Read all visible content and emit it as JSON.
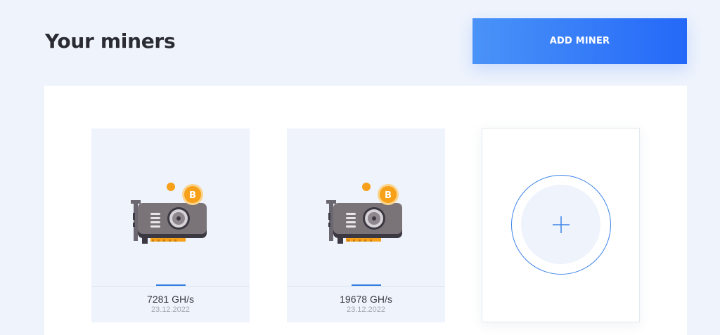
{
  "header": {
    "title": "Your miners",
    "add_button_label": "ADD MINER"
  },
  "colors": {
    "accent": "#2468f8",
    "background": "#eef3fc",
    "bitcoin": "#f7a11a"
  },
  "miners": [
    {
      "icon": "gpu-miner-icon",
      "hashrate": "7281 GH/s",
      "date": "23.12.2022"
    },
    {
      "icon": "gpu-miner-icon",
      "hashrate": "19678 GH/s",
      "date": "23.12.2022"
    }
  ],
  "add_card": {
    "icon": "plus-icon"
  }
}
